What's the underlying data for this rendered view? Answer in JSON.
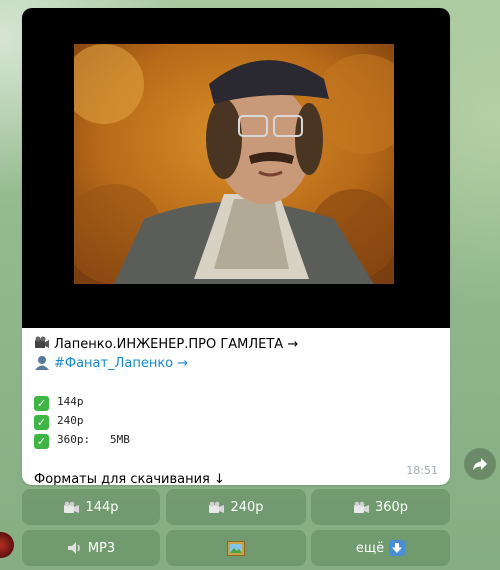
{
  "message": {
    "title_link": "Лапенко.ИНЖЕНЕР.ПРО ГАМЛЕТА →",
    "tag_link": "#Фанат_Лапенко →",
    "formats": [
      {
        "label": "144p"
      },
      {
        "label": "240p"
      },
      {
        "label": "360p:   5MB"
      }
    ],
    "footer_text": "Форматы для скачивания ↓",
    "time": "18:51"
  },
  "keyboard": {
    "row1": [
      "144p",
      "240p",
      "360p"
    ],
    "row2": {
      "mp3": "MP3",
      "more": "ещё"
    }
  },
  "icons": {
    "title": "movie-camera-icon",
    "tag": "user-silhouette-icon",
    "format": "check-mark-icon",
    "share": "share-arrow-icon",
    "mp3": "speaker-icon",
    "picture": "framed-picture-icon",
    "more": "down-arrow-icon"
  },
  "colors": {
    "link": "#168acd",
    "check": "#3eb544",
    "time": "#a0acb6"
  }
}
